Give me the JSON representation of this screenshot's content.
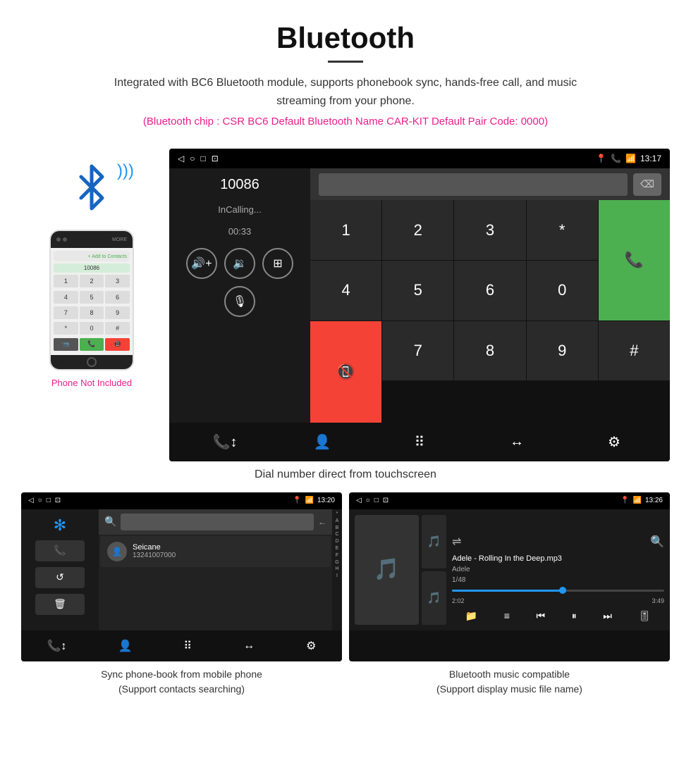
{
  "header": {
    "title": "Bluetooth",
    "description": "Integrated with BC6 Bluetooth module, supports phonebook sync, hands-free call, and music streaming from your phone.",
    "info_line": "(Bluetooth chip : CSR BC6    Default Bluetooth Name CAR-KIT    Default Pair Code: 0000)"
  },
  "main_screen": {
    "status_bar": {
      "left_icons": [
        "◁",
        "○",
        "□",
        "⊡"
      ],
      "right_icons": [
        "📍",
        "📞",
        "📶"
      ],
      "time": "13:17"
    },
    "dial": {
      "number": "10086",
      "status": "InCalling...",
      "timer": "00:33"
    },
    "keypad": {
      "keys": [
        "1",
        "2",
        "3",
        "*",
        "4",
        "5",
        "6",
        "0",
        "7",
        "8",
        "9",
        "#"
      ]
    },
    "caption": "Dial number direct from touchscreen"
  },
  "phone_sidebar": {
    "not_included": "Phone Not Included"
  },
  "phonebook_screen": {
    "status_bar": {
      "left_icons": [
        "◁",
        "○",
        "□",
        "⊡"
      ],
      "right_icons": [
        "📍",
        "📶"
      ],
      "time": "13:20"
    },
    "contact_name": "Seicane",
    "contact_phone": "13241007000",
    "alphabet": [
      "*",
      "A",
      "B",
      "C",
      "D",
      "E",
      "F",
      "G",
      "H",
      "I"
    ],
    "caption_line1": "Sync phone-book from mobile phone",
    "caption_line2": "(Support contacts searching)"
  },
  "music_screen": {
    "status_bar": {
      "left_icons": [
        "◁",
        "○",
        "□",
        "⊡"
      ],
      "right_icons": [
        "📍",
        "📶"
      ],
      "time": "13:26"
    },
    "track": "Adele - Rolling In the Deep.mp3",
    "artist": "Adele",
    "counter": "1/48",
    "time_current": "2:02",
    "time_total": "3:49",
    "caption_line1": "Bluetooth music compatible",
    "caption_line2": "(Support display music file name)"
  }
}
